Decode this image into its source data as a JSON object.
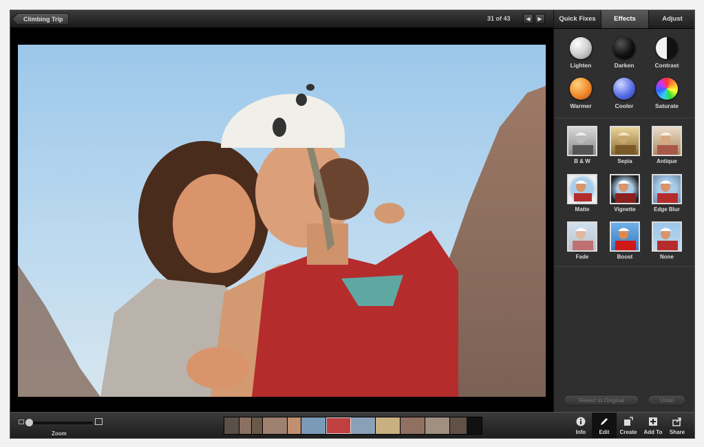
{
  "titlebar": {
    "back_label": "Climbing Trip",
    "counter": "31 of 43",
    "prev_icon": "◀",
    "next_icon": "▶"
  },
  "tabs": [
    {
      "label": "Quick Fixes",
      "active": false
    },
    {
      "label": "Effects",
      "active": true
    },
    {
      "label": "Adjust",
      "active": false
    }
  ],
  "quick_fixes": [
    {
      "label": "Lighten",
      "color": "#e6e6e6"
    },
    {
      "label": "Darken",
      "color": "#1a1a1a"
    },
    {
      "label": "Contrast",
      "color": "#888888"
    },
    {
      "label": "Warmer",
      "color": "#f08a2c"
    },
    {
      "label": "Cooler",
      "color": "#5a6fe6"
    },
    {
      "label": "Saturate",
      "color": "#e04a9c"
    }
  ],
  "effects": [
    {
      "label": "B & W"
    },
    {
      "label": "Sepia"
    },
    {
      "label": "Antique"
    },
    {
      "label": "Matte"
    },
    {
      "label": "Vignette"
    },
    {
      "label": "Edge Blur"
    },
    {
      "label": "Fade"
    },
    {
      "label": "Boost"
    },
    {
      "label": "None"
    }
  ],
  "panel_buttons": {
    "revert": "Revert to Original",
    "undo": "Undo"
  },
  "bottombar": {
    "zoom_label": "Zoom",
    "tools": [
      {
        "label": "Info",
        "icon": "info-icon"
      },
      {
        "label": "Edit",
        "icon": "pencil-icon"
      },
      {
        "label": "Create",
        "icon": "create-icon"
      },
      {
        "label": "Add To",
        "icon": "add-icon"
      },
      {
        "label": "Share",
        "icon": "share-icon"
      }
    ]
  }
}
